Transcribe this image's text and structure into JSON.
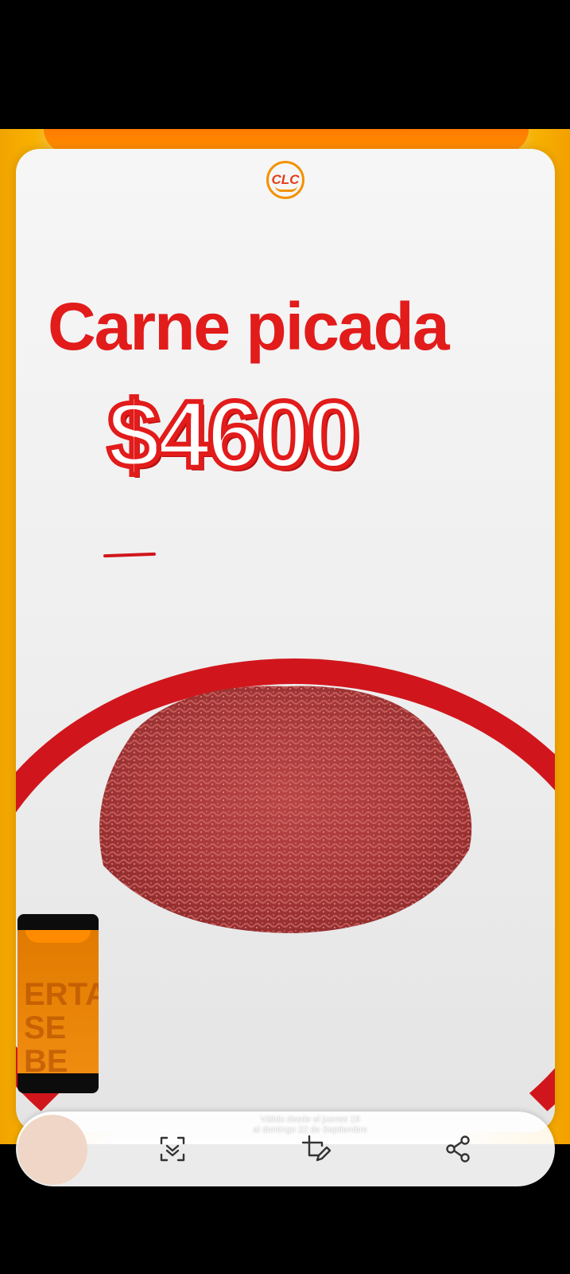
{
  "ad": {
    "logo_text": "CLC",
    "title": "Carne picada",
    "price": "$4600",
    "thumbnail_text": "ERTA\nSE BE"
  },
  "toolbar": {
    "caption_line1": "Válido desde el jueves 19",
    "caption_line2": "al domingo 22 de Septiembre",
    "buttons": [
      {
        "name": "scan",
        "icon": "scan-icon"
      },
      {
        "name": "edit",
        "icon": "crop-edit-icon"
      },
      {
        "name": "share",
        "icon": "share-icon"
      }
    ]
  },
  "colors": {
    "accent_red": "#e21b1b",
    "orange": "#f39200"
  }
}
